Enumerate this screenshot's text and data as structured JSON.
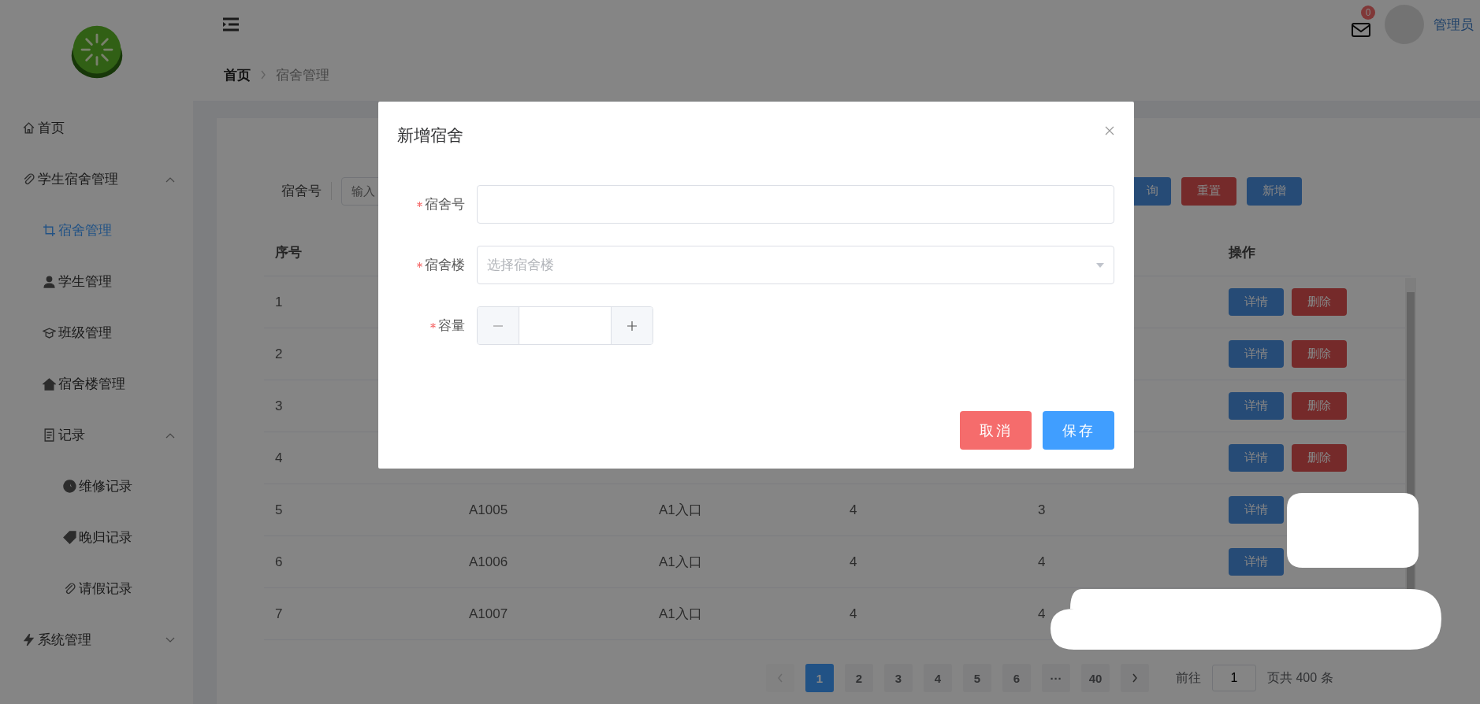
{
  "sidebar": {
    "items": [
      {
        "label": "首页",
        "selected": false
      },
      {
        "label": "学生宿舍管理",
        "expanded": true,
        "children": [
          {
            "label": "宿舍管理",
            "selected": true
          },
          {
            "label": "学生管理",
            "selected": false
          },
          {
            "label": "班级管理",
            "selected": false
          },
          {
            "label": "宿舍楼管理",
            "selected": false
          },
          {
            "label": "记录",
            "expanded": true,
            "children": [
              {
                "label": "维修记录",
                "selected": false
              },
              {
                "label": "晚归记录",
                "selected": false
              },
              {
                "label": "请假记录",
                "selected": false
              }
            ]
          }
        ]
      },
      {
        "label": "系统管理",
        "expanded": false
      }
    ]
  },
  "header": {
    "mail_badge": "0",
    "user": "管理员"
  },
  "breadcrumb": [
    "首页",
    "宿舍管理"
  ],
  "search": {
    "label": "宿舍号",
    "placeholder": "输入",
    "buttons": [
      {
        "label": "询",
        "kind": "primary"
      },
      {
        "label": "重置",
        "kind": "danger"
      },
      {
        "label": "新增",
        "kind": "primary"
      }
    ]
  },
  "table": {
    "columns": [
      "序号",
      "操作"
    ],
    "rows": [
      {
        "no": "1",
        "actions": [
          "详情",
          "删除"
        ]
      },
      {
        "no": "2",
        "actions": [
          "详情",
          "删除"
        ]
      },
      {
        "no": "3",
        "actions": [
          "详情",
          "删除"
        ]
      },
      {
        "no": "4",
        "actions": [
          "详情",
          "删除"
        ]
      },
      {
        "no": "5",
        "dorm": "A1005",
        "building": "A1入口",
        "capacity": "4",
        "column_5": "3",
        "actions": [
          "详情"
        ]
      },
      {
        "no": "6",
        "dorm": "A1006",
        "building": "A1入口",
        "capacity": "4",
        "column_5": "4",
        "actions": [
          "详情"
        ]
      },
      {
        "no": "7",
        "dorm": "A1007",
        "building": "A1入口",
        "capacity": "4",
        "column_5": "4",
        "actions": []
      }
    ]
  },
  "pagination": {
    "prev_disabled": true,
    "pages": [
      {
        "label": "1",
        "selected": true
      },
      {
        "label": "2",
        "selected": false
      },
      {
        "label": "3",
        "selected": false
      },
      {
        "label": "4",
        "selected": false
      },
      {
        "label": "5",
        "selected": false
      },
      {
        "label": "6",
        "selected": false
      },
      {
        "label": "···",
        "selected": false
      },
      {
        "label": "40",
        "selected": false
      }
    ],
    "next_disabled": false,
    "goto_label": "前往",
    "goto_value": "1",
    "total": "页共 400 条"
  },
  "dialog": {
    "title": "新增宿舍",
    "fields": [
      {
        "label": "宿舍号",
        "kind": "text",
        "required": true
      },
      {
        "label": "宿舍楼",
        "kind": "select",
        "required": true,
        "placeholder": "选择宿舍楼"
      },
      {
        "label": "容量",
        "kind": "number",
        "required": true
      }
    ],
    "buttons": [
      {
        "label": "取消",
        "kind": "danger"
      },
      {
        "label": "保存",
        "kind": "primary"
      }
    ]
  }
}
